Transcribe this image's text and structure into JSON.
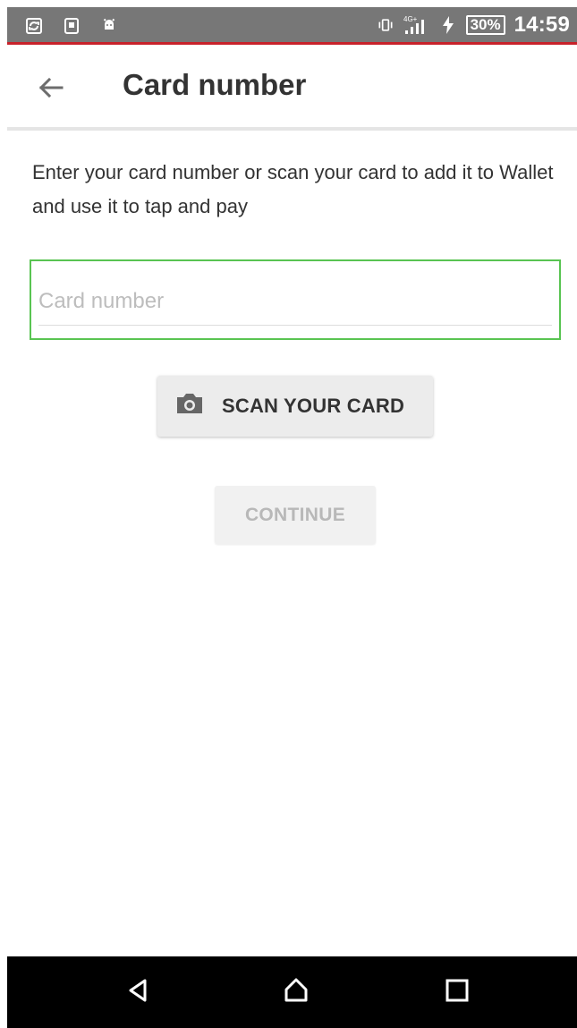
{
  "status_bar": {
    "battery_level": "30%",
    "time": "14:59",
    "network_label": "4G+",
    "icons": {
      "left": [
        "sync-icon",
        "sim-icon",
        "android-icon"
      ],
      "right": [
        "vibrate-icon",
        "signal-icon",
        "charging-icon",
        "battery-icon"
      ]
    }
  },
  "header": {
    "title": "Card number",
    "back_icon": "back-arrow-icon"
  },
  "content": {
    "description": "Enter your card number or scan your card to add it to Wallet and use it to tap and pay"
  },
  "card_input": {
    "value": "",
    "placeholder": "Card number"
  },
  "buttons": {
    "scan_label": "SCAN YOUR CARD",
    "continue_label": "CONTINUE"
  },
  "navigation": {
    "back_icon": "nav-back-icon",
    "home_icon": "nav-home-icon",
    "recents_icon": "nav-recents-icon"
  },
  "colors": {
    "status_bar_bg": "#777777",
    "status_bar_accent": "#c8212a",
    "field_focus": "#59c452",
    "primary_text": "#333333",
    "disabled_text": "#b8b8b8"
  }
}
